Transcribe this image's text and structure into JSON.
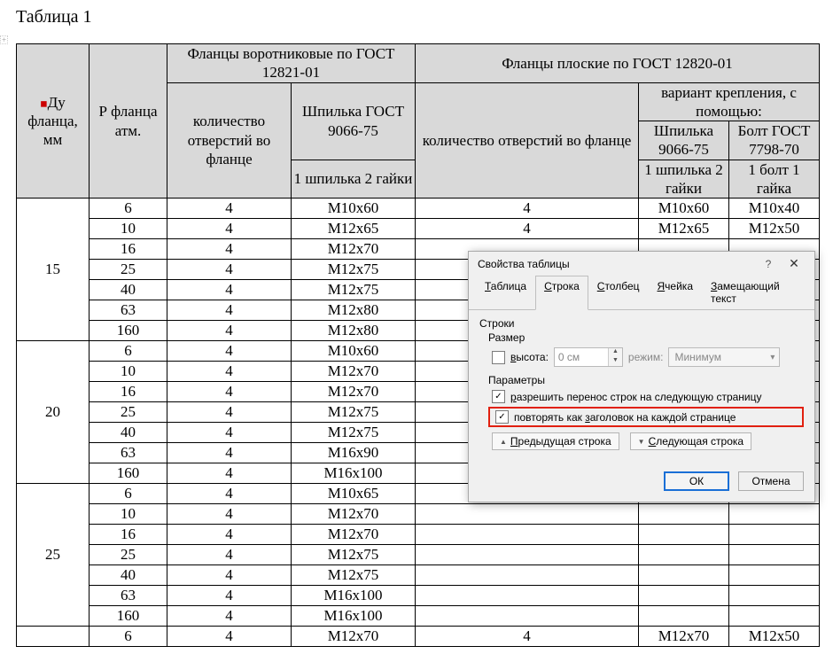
{
  "caption": "Таблица 1",
  "anchor_mark": "+",
  "header": {
    "du": "Ду фланца, мм",
    "p": "Р фланца атм.",
    "left_group": "Фланцы воротниковые по ГОСТ 12821-01",
    "right_group": "Фланцы плоские по ГОСТ 12820-01",
    "qty": "количество отверстий во фланце",
    "stud": "Шпилька ГОСТ 9066-75",
    "stud_sub": "1 шпилька 2 гайки",
    "qty2": "количество   отверстий во фланце",
    "variant": "вариант крепления, с помощью:",
    "v1": "Шпилька 9066-75",
    "v2": "Болт ГОСТ 7798-70",
    "v1s": "1 шпилька 2 гайки",
    "v2s": "1 болт 1 гайка"
  },
  "groups": [
    {
      "du": "15",
      "rows": [
        {
          "p": "6",
          "q": "4",
          "s": "М10х60",
          "q2": "4",
          "v1": "М10х60",
          "v2": "М10х40"
        },
        {
          "p": "10",
          "q": "4",
          "s": "М12х65",
          "q2": "4",
          "v1": "М12х65",
          "v2": "М12х50"
        },
        {
          "p": "16",
          "q": "4",
          "s": "М12х70",
          "q2": "",
          "v1": "",
          "v2": ""
        },
        {
          "p": "25",
          "q": "4",
          "s": "М12х75",
          "q2": "",
          "v1": "",
          "v2": ""
        },
        {
          "p": "40",
          "q": "4",
          "s": "М12х75",
          "q2": "",
          "v1": "",
          "v2": ""
        },
        {
          "p": "63",
          "q": "4",
          "s": "М12х80",
          "q2": "",
          "v1": "",
          "v2": ""
        },
        {
          "p": "160",
          "q": "4",
          "s": "М12х80",
          "q2": "",
          "v1": "",
          "v2": ""
        }
      ]
    },
    {
      "du": "20",
      "rows": [
        {
          "p": "6",
          "q": "4",
          "s": "М10х60",
          "q2": "",
          "v1": "",
          "v2": ""
        },
        {
          "p": "10",
          "q": "4",
          "s": "М12х70",
          "q2": "",
          "v1": "",
          "v2": ""
        },
        {
          "p": "16",
          "q": "4",
          "s": "М12х70",
          "q2": "",
          "v1": "",
          "v2": ""
        },
        {
          "p": "25",
          "q": "4",
          "s": "М12х75",
          "q2": "",
          "v1": "",
          "v2": ""
        },
        {
          "p": "40",
          "q": "4",
          "s": "М12х75",
          "q2": "",
          "v1": "",
          "v2": ""
        },
        {
          "p": "63",
          "q": "4",
          "s": "М16х90",
          "q2": "",
          "v1": "",
          "v2": ""
        },
        {
          "p": "160",
          "q": "4",
          "s": "М16х100",
          "q2": "",
          "v1": "",
          "v2": ""
        }
      ]
    },
    {
      "du": "25",
      "rows": [
        {
          "p": "6",
          "q": "4",
          "s": "М10х65",
          "q2": "",
          "v1": "",
          "v2": ""
        },
        {
          "p": "10",
          "q": "4",
          "s": "М12х70",
          "q2": "",
          "v1": "",
          "v2": ""
        },
        {
          "p": "16",
          "q": "4",
          "s": "М12х70",
          "q2": "",
          "v1": "",
          "v2": ""
        },
        {
          "p": "25",
          "q": "4",
          "s": "М12х75",
          "q2": "",
          "v1": "",
          "v2": ""
        },
        {
          "p": "40",
          "q": "4",
          "s": "М12х75",
          "q2": "",
          "v1": "",
          "v2": ""
        },
        {
          "p": "63",
          "q": "4",
          "s": "М16х100",
          "q2": "",
          "v1": "",
          "v2": ""
        },
        {
          "p": "160",
          "q": "4",
          "s": "М16х100",
          "q2": "",
          "v1": "",
          "v2": ""
        }
      ]
    }
  ],
  "lastrow": {
    "du": "",
    "p": "6",
    "q": "4",
    "s": "М12х70",
    "q2": "4",
    "v1": "М12х70",
    "v2": "М12х50"
  },
  "dialog": {
    "title": "Свойства таблицы",
    "tabs": [
      "Таблица",
      "Строка",
      "Столбец",
      "Ячейка",
      "Замещающий текст"
    ],
    "active_tab": 1,
    "section_rows": "Строки",
    "size_label": "Размер",
    "height_label": "высота:",
    "height_value": "0 см",
    "mode_label": "режим:",
    "mode_value": "Минимум",
    "params_label": "Параметры",
    "opt1": "разрешить перенос строк на следующую страницу",
    "opt2": "повторять как заголовок на каждой странице",
    "prev": "Предыдущая строка",
    "next": "Следующая строка",
    "ok": "ОК",
    "cancel": "Отмена"
  },
  "underline_map": {
    "Таблица": "Т",
    "Строка": "С",
    "Столбец": "Ст",
    "Ячейка": "Я",
    "Замещающий текст": "З",
    "высота:": "в",
    "Предыдущая строка": "П",
    "Следующая строка": "С",
    "заголовок": "з",
    "разрешить": "р"
  }
}
